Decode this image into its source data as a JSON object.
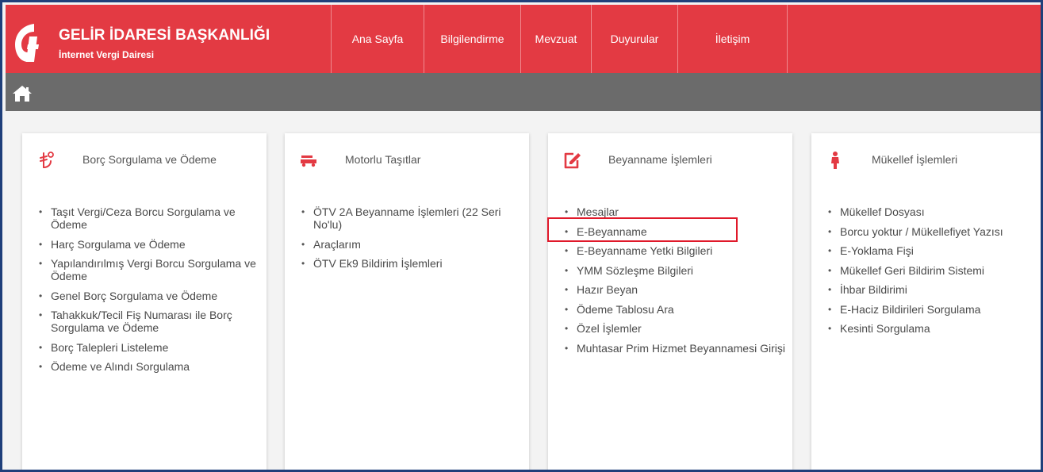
{
  "header": {
    "title": "GELİR İDARESİ BAŞKANLIĞI",
    "subtitle": "İnternet Vergi Dairesi",
    "brand_color": "#e33a43"
  },
  "nav": [
    {
      "label": "Ana Sayfa"
    },
    {
      "label": "Bilgilendirme"
    },
    {
      "label": "Mevzuat"
    },
    {
      "label": "Duyurular"
    },
    {
      "label": "İletişim"
    }
  ],
  "subbar": {
    "icon": "home-icon"
  },
  "cards": [
    {
      "title": "Borç Sorgulama ve Ödeme",
      "icon": "lira-coins-icon",
      "items": [
        "Taşıt Vergi/Ceza Borcu Sorgulama ve Ödeme",
        "Harç Sorgulama ve Ödeme",
        "Yapılandırılmış Vergi Borcu Sorgulama ve Ödeme",
        "Genel Borç Sorgulama ve Ödeme",
        "Tahakkuk/Tecil Fiş Numarası ile Borç Sorgulama ve Ödeme",
        "Borç Talepleri Listeleme",
        "Ödeme ve Alındı Sorgulama"
      ]
    },
    {
      "title": "Motorlu Taşıtlar",
      "icon": "vehicle-icon",
      "items": [
        "ÖTV 2A Beyanname İşlemleri (22 Seri No'lu)",
        "Araçlarım",
        "ÖTV Ek9 Bildirim İşlemleri"
      ]
    },
    {
      "title": "Beyanname İşlemleri",
      "icon": "edit-document-icon",
      "items": [
        "Mesajlar",
        "E-Beyanname",
        "E-Beyanname Yetki Bilgileri",
        "YMM Sözleşme Bilgileri",
        "Hazır Beyan",
        "Ödeme Tablosu Ara",
        "Özel İşlemler",
        "Muhtasar Prim Hizmet Beyannamesi Girişi"
      ]
    },
    {
      "title": "Mükellef İşlemleri",
      "icon": "person-icon",
      "items": [
        "Mükellef Dosyası",
        "Borcu yoktur / Mükellefiyet Yazısı",
        "E-Yoklama Fişi",
        "Mükellef Geri Bildirim Sistemi",
        "İhbar Bildirimi",
        "E-Haciz Bildirileri Sorgulama",
        "Kesinti Sorgulama"
      ]
    }
  ],
  "highlighted_item": "E-Beyanname",
  "highlight_color": "#e0192a"
}
